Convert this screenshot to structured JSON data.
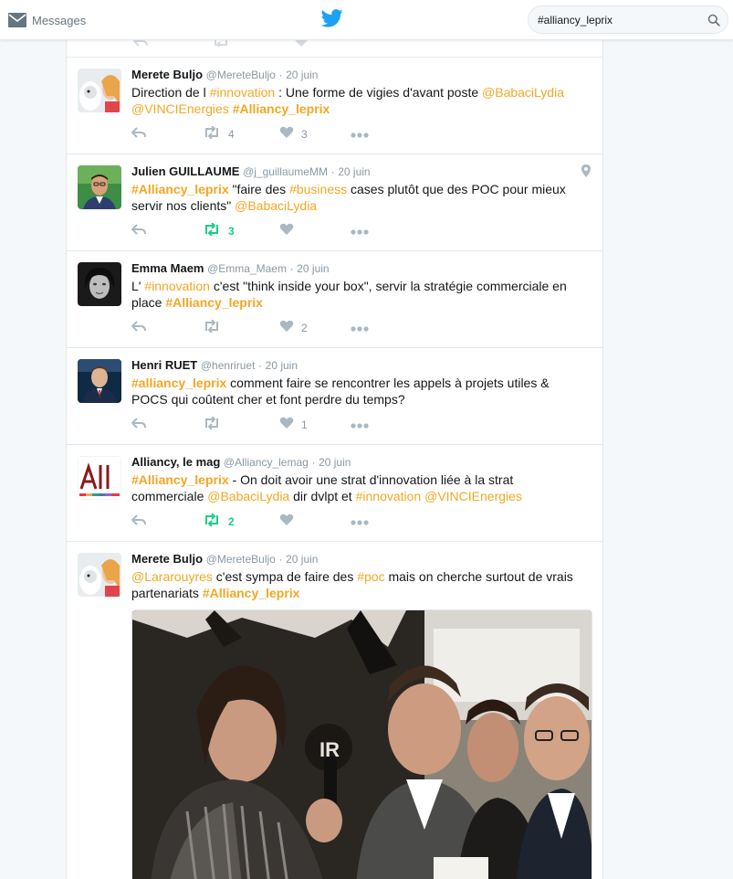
{
  "topbar": {
    "messages_label": "Messages",
    "search_value": "#alliancy_leprix"
  },
  "colors": {
    "link": "#f5a623",
    "retweet_active": "#19cf86",
    "muted": "#8899a6"
  },
  "tweets": [
    {
      "fullname": "Merete Buljo",
      "username": "@MereteBuljo",
      "sep": "·",
      "time": "20 juin",
      "text_parts": [
        "Direction de l ",
        "#innovation",
        " : Une forme de vigies d'avant poste ",
        "@BabaciLydia",
        " ",
        "@VINCIEnergies",
        " ",
        "#Alliancy_leprix"
      ],
      "retweets": "4",
      "likes": "3"
    },
    {
      "fullname": "Julien GUILLAUME",
      "username": "@j_guillaumeMM",
      "sep": "·",
      "time": "20 juin",
      "text_parts": [
        "#Alliancy_leprix",
        " \"faire des ",
        "#business",
        " cases plutôt que des POC pour mieux servir nos clients\" ",
        "@BabaciLydia"
      ],
      "retweets": "3",
      "likes": ""
    },
    {
      "fullname": "Emma Maem",
      "username": "@Emma_Maem",
      "sep": "·",
      "time": "20 juin",
      "text_parts": [
        "L' ",
        "#innovation",
        " c'est \"think inside your box\", servir la stratégie commerciale en place ",
        "#Alliancy_leprix"
      ],
      "retweets": "",
      "likes": "2"
    },
    {
      "fullname": "Henri RUET",
      "username": "@henriruet",
      "sep": "·",
      "time": "20 juin",
      "text_parts": [
        "#alliancy_leprix",
        " comment faire se rencontrer les appels à projets utiles & POCS qui coûtent cher et font perdre du temps?"
      ],
      "retweets": "",
      "likes": "1"
    },
    {
      "fullname": "Alliancy, le mag",
      "username": "@Alliancy_lemag",
      "sep": "·",
      "time": "20 juin",
      "text_parts": [
        "#Alliancy_leprix",
        " - On doit avoir une strat d'innovation liée à la strat commerciale ",
        "@BabaciLydia",
        " dir dvlpt et ",
        "#innovation",
        " ",
        "@VINCIEnergies"
      ],
      "retweets": "2",
      "likes": ""
    },
    {
      "fullname": "Merete Buljo",
      "username": "@MereteBuljo",
      "sep": "·",
      "time": "20 juin",
      "text_parts": [
        "@Lararouyres",
        " c'est sympa de faire des ",
        "#poc",
        " mais on cherche surtout de vrais partenariats ",
        "#Alliancy_leprix"
      ],
      "retweets": "",
      "likes": ""
    }
  ]
}
